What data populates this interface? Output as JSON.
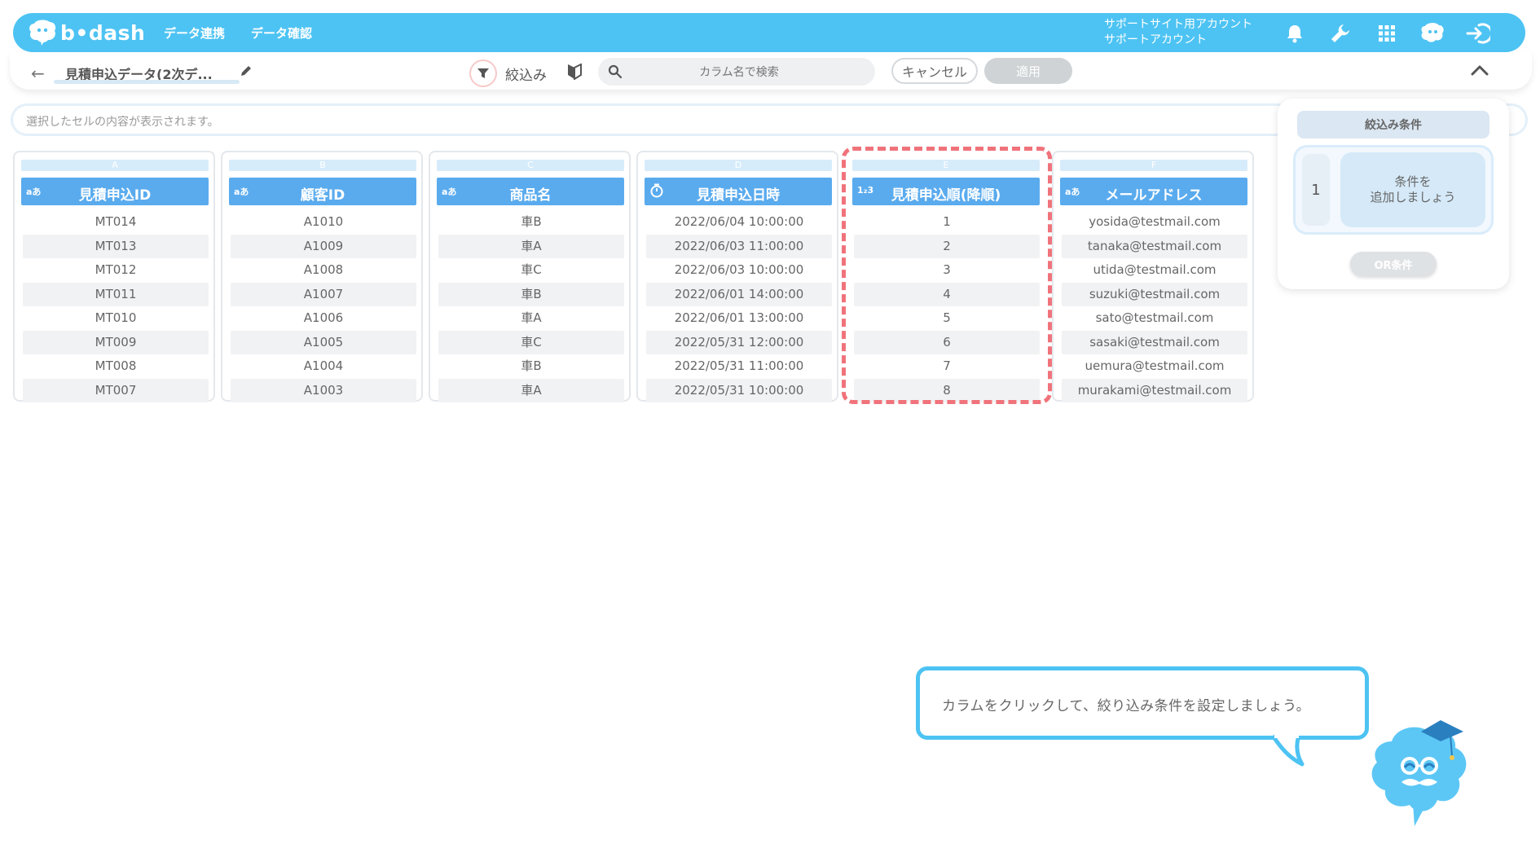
{
  "header": {
    "brand": "b•dash",
    "nav": [
      "データ連携",
      "データ確認"
    ],
    "account_line1": "サポートサイト用アカウント",
    "account_line2": "サポートアカウント",
    "icons": [
      "bell-icon",
      "wrench-icon",
      "apps-grid-icon",
      "mascot-chat-icon",
      "logout-icon"
    ]
  },
  "toolbar": {
    "back": "←",
    "dataset_title": "見積申込データ(2次デ...",
    "filter_label": "絞込み",
    "search_placeholder": "カラム名で検索",
    "cancel_label": "キャンセル",
    "apply_label": "適用"
  },
  "cellbar": {
    "placeholder": "選択したセルの内容が表示されます。"
  },
  "table": {
    "columns": [
      {
        "letter": "A",
        "type": "aあ",
        "name": "見積申込ID",
        "values": [
          "MT014",
          "MT013",
          "MT012",
          "MT011",
          "MT010",
          "MT009",
          "MT008",
          "MT007"
        ]
      },
      {
        "letter": "B",
        "type": "aあ",
        "name": "顧客ID",
        "values": [
          "A1010",
          "A1009",
          "A1008",
          "A1007",
          "A1006",
          "A1005",
          "A1004",
          "A1003"
        ]
      },
      {
        "letter": "C",
        "type": "aあ",
        "name": "商品名",
        "values": [
          "車B",
          "車A",
          "車C",
          "車B",
          "車A",
          "車C",
          "車B",
          "車A"
        ]
      },
      {
        "letter": "D",
        "type": "clock",
        "name": "見積申込日時",
        "values": [
          "2022/06/04 10:00:00",
          "2022/06/03 11:00:00",
          "2022/06/03 10:00:00",
          "2022/06/01 14:00:00",
          "2022/06/01 13:00:00",
          "2022/05/31 12:00:00",
          "2022/05/31 11:00:00",
          "2022/05/31 10:00:00"
        ]
      },
      {
        "letter": "E",
        "type": "1₂3",
        "name": "見積申込順(降順)",
        "values": [
          "1",
          "2",
          "3",
          "4",
          "5",
          "6",
          "7",
          "8"
        ]
      },
      {
        "letter": "F",
        "type": "aあ",
        "name": "メールアドレス",
        "values": [
          "yosida@testmail.com",
          "tanaka@testmail.com",
          "utida@testmail.com",
          "suzuki@testmail.com",
          "sato@testmail.com",
          "sasaki@testmail.com",
          "uemura@testmail.com",
          "murakami@testmail.com"
        ]
      }
    ]
  },
  "panel": {
    "title": "絞込み条件",
    "condition_number": "1",
    "add_line1": "条件を",
    "add_line2": "追加しましょう",
    "or_label": "OR条件"
  },
  "guide": {
    "text": "カラムをクリックして、絞り込み条件を設定しましょう。"
  },
  "colors": {
    "header_blue": "#4dc3f3",
    "column_head_blue": "#5aabee",
    "highlight_red": "#f0737b"
  }
}
